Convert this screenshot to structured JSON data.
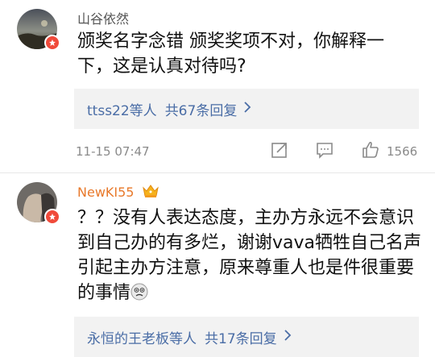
{
  "comments": [
    {
      "username": "山谷依然",
      "text_lines": [
        "颁奖名字念错  颁奖奖项不对，你解释一",
        "下，这是认真对待吗?"
      ],
      "reply_summary": {
        "users": "ttss22等人",
        "count": "共67条回复"
      },
      "timestamp": "11-15 07:47",
      "like_count": "1566"
    },
    {
      "username": "NewKI55",
      "text_lines": [
        "？？没有人表达态度，主办方永远不会意识",
        "到自己办的有多烂，谢谢vava牺牲自己名声",
        "引起主办方注意，原来尊重人也是件很重要",
        "的事情"
      ],
      "reply_summary": {
        "users": "永恒的王老板等人",
        "count": "共17条回复"
      }
    }
  ],
  "colors": {
    "username": "#555555",
    "vip_username": "#e8792b",
    "link": "#4a6da6",
    "badge": "#f04a3a"
  },
  "icons": [
    "verified-badge-icon",
    "vip-crown-icon",
    "share-icon",
    "comment-icon",
    "like-icon",
    "chevron-right-icon",
    "emoji-icon"
  ]
}
